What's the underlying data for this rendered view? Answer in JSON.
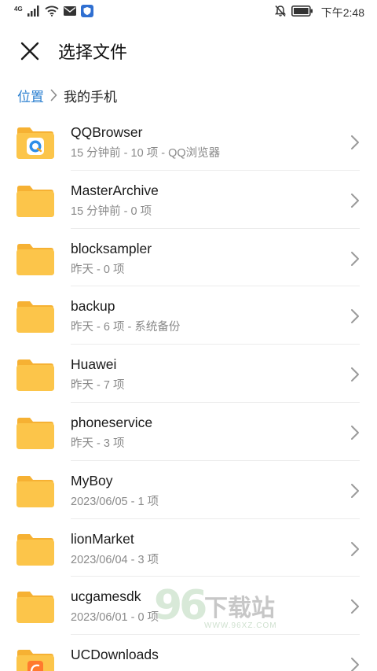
{
  "status_bar": {
    "network": "4G",
    "time": "下午2:48"
  },
  "app_bar": {
    "title": "选择文件"
  },
  "breadcrumb": {
    "root": "位置",
    "current": "我的手机"
  },
  "files": [
    {
      "name": "QQBrowser",
      "meta": "15 分钟前 - 10 项 - QQ浏览器",
      "icon": "qqbrowser-folder-icon"
    },
    {
      "name": "MasterArchive",
      "meta": "15 分钟前 - 0 项",
      "icon": "folder-icon"
    },
    {
      "name": "blocksampler",
      "meta": "昨天 - 0 项",
      "icon": "folder-icon"
    },
    {
      "name": "backup",
      "meta": "昨天 - 6 项 - 系统备份",
      "icon": "folder-icon"
    },
    {
      "name": "Huawei",
      "meta": "昨天 - 7 项",
      "icon": "folder-icon"
    },
    {
      "name": "phoneservice",
      "meta": "昨天 - 3 项",
      "icon": "folder-icon"
    },
    {
      "name": "MyBoy",
      "meta": "2023/06/05 - 1 项",
      "icon": "folder-icon"
    },
    {
      "name": "lionMarket",
      "meta": "2023/06/04 - 3 项",
      "icon": "folder-icon"
    },
    {
      "name": "ucgamesdk",
      "meta": "2023/06/01 - 0 项",
      "icon": "folder-icon"
    },
    {
      "name": "UCDownloads",
      "meta": "",
      "icon": "uc-folder-icon"
    }
  ],
  "watermark": {
    "number": "96",
    "text": "下载站",
    "url": "WWW.96XZ.COM"
  },
  "colors": {
    "accent": "#2a7fd0",
    "folder": "#fcc54a",
    "folder_tab": "#f6b133"
  }
}
